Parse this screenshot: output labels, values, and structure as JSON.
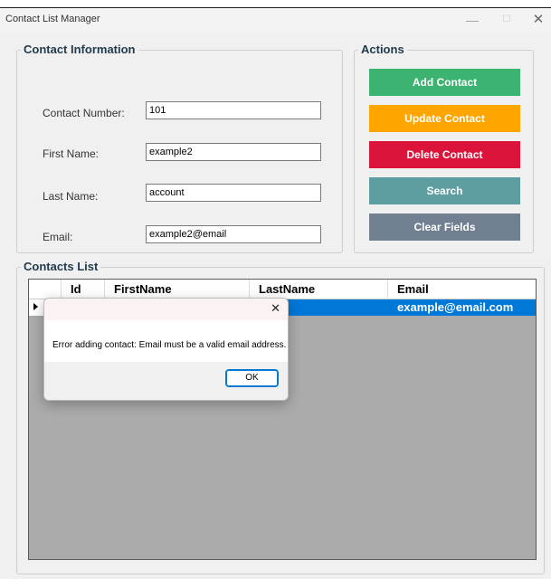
{
  "window": {
    "title": "Contact List Manager",
    "minimize_glyph": "—",
    "maximize_glyph": "☐",
    "close_glyph": "✕"
  },
  "contact_info": {
    "title": "Contact Information",
    "fields": [
      {
        "label": "Contact Number:",
        "value": "101"
      },
      {
        "label": "First Name:",
        "value": "example2"
      },
      {
        "label": "Last Name:",
        "value": "account"
      },
      {
        "label": "Email:",
        "value": "example2@email"
      }
    ]
  },
  "actions": {
    "title": "Actions",
    "buttons": [
      {
        "label": "Add Contact",
        "color": "#3cb371"
      },
      {
        "label": "Update Contact",
        "color": "#ffa500"
      },
      {
        "label": "Delete Contact",
        "color": "#dc143c"
      },
      {
        "label": "Search",
        "color": "#5f9ea0"
      },
      {
        "label": "Clear Fields",
        "color": "#708090"
      }
    ]
  },
  "contacts_list": {
    "title": "Contacts List",
    "columns": [
      "Id",
      "FirstName",
      "LastName",
      "Email"
    ],
    "rows": [
      {
        "id": "",
        "first_name": "",
        "last_name": "nt",
        "email": "example@email.com"
      }
    ],
    "selection_color": "#0078d7"
  },
  "dialog": {
    "message": "Error adding contact: Email must be a valid email address.",
    "ok_label": "OK",
    "close_glyph": "✕"
  }
}
